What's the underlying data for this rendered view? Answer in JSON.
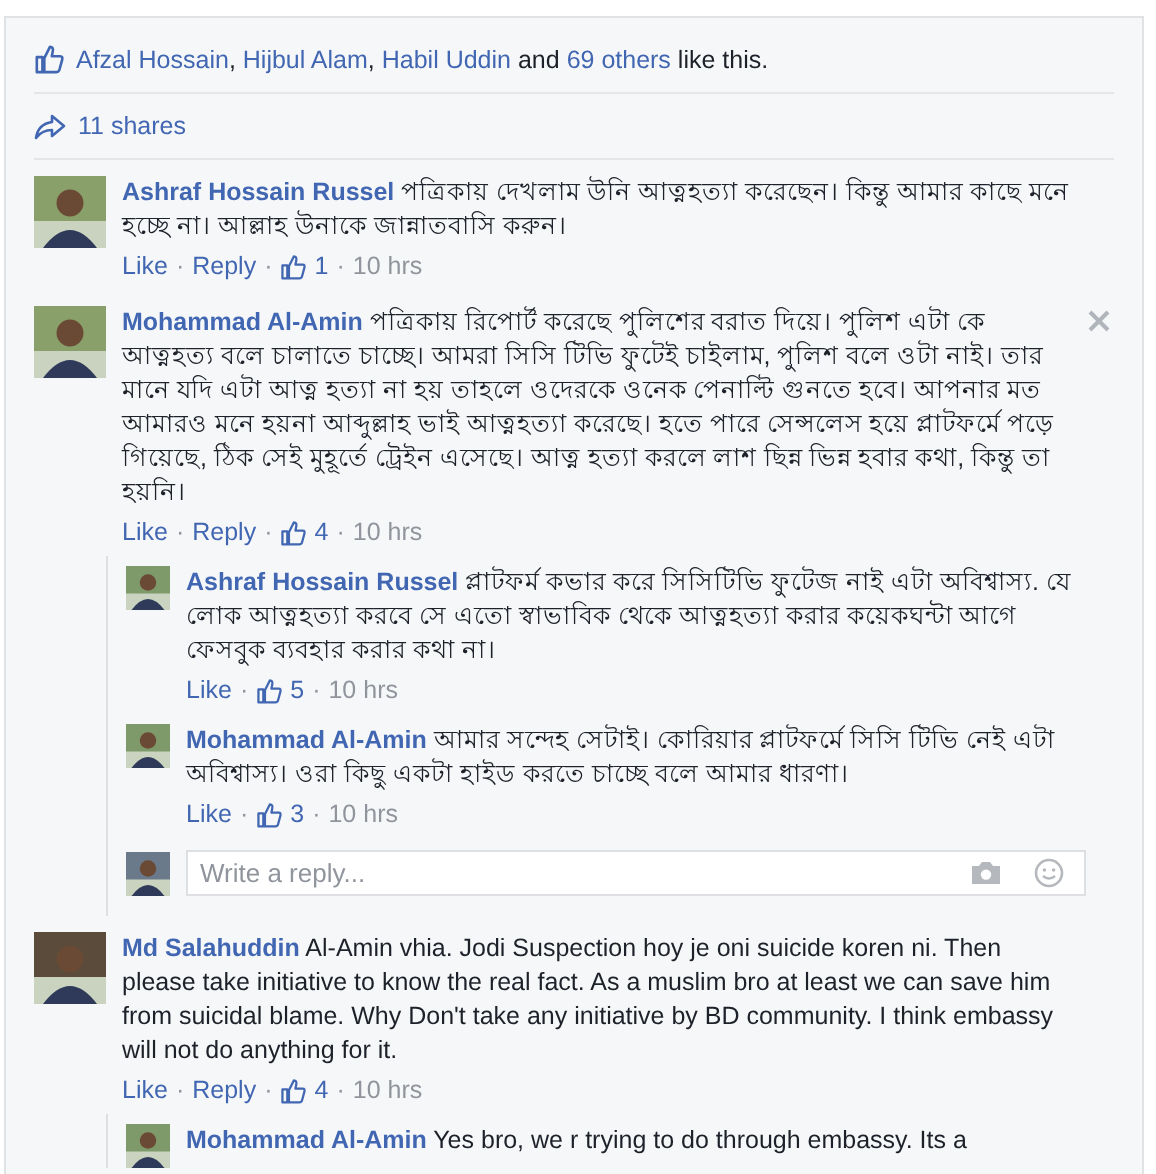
{
  "likes_line": {
    "parts": [
      {
        "text": "Afzal Hossain",
        "link": true
      },
      {
        "text": ", ",
        "link": false
      },
      {
        "text": "Hijbul Alam",
        "link": true
      },
      {
        "text": ", ",
        "link": false
      },
      {
        "text": "Habil Uddin",
        "link": true
      },
      {
        "text": " and ",
        "link": false
      },
      {
        "text": "69 others",
        "link": true
      },
      {
        "text": " like this.",
        "link": false
      }
    ]
  },
  "shares": "11 shares",
  "separator": "·",
  "comments": [
    {
      "author": "Ashraf Hossain Russel",
      "text": "পত্রিকায় দেখলাম উনি আত্নহত্যা করেছেন। কিন্তু আমার কাছে মনে হচ্ছে না। আল্লাহ উনাকে জান্নাতবাসি করুন।",
      "like": "Like",
      "reply": "Reply",
      "likes": "1",
      "time": "10 hrs",
      "closable": false
    },
    {
      "author": "Mohammad Al-Amin",
      "text": "পত্রিকায় রিপোর্ট করেছে পুলিশের বরাত দিয়ে। পুলিশ এটা কে আত্নহত্য বলে চালাতে চাচ্ছে। আমরা সিসি টিভি ফুটেই চাইলাম, পুলিশ বলে ওটা নাই। তার মানে যদি এটা আত্ন হত্যা না হয় তাহলে ওদেরকে ওনেক পেনাল্টি গুনতে হবে। আপনার মত আমারও মনে হয়না আব্দুল্লাহ ভাই আত্নহত্যা করেছে। হতে পারে সেন্সলেস হয়ে প্লাটফর্মে পড়ে গিয়েছে, ঠিক সেই মুহূর্তে ট্রেইন এসেছে। আত্ন হত্যা করলে লাশ ছিন্ন ভিন্ন হবার কথা, কিন্তু তা হয়নি।",
      "like": "Like",
      "reply": "Reply",
      "likes": "4",
      "time": "10 hrs",
      "closable": true,
      "replies": [
        {
          "author": "Ashraf Hossain Russel",
          "text": "প্লাটফর্ম কভার করে সিসিটিভি ফুটেজ নাই এটা অবিশ্বাস্য. যে লোক আত্নহত্যা করবে সে এতো স্বাভাবিক থেকে আত্নহত্যা করার কয়েকঘন্টা আগে ফেসবুক ব্যবহার করার কথা না।",
          "like": "Like",
          "likes": "5",
          "time": "10 hrs"
        },
        {
          "author": "Mohammad Al-Amin",
          "text": "আমার সন্দেহ সেটাই। কোরিয়ার প্লাটফর্মে সিসি টিভি নেই এটা অবিশ্বাস্য। ওরা কিছু একটা হাইড করতে চাচ্ছে বলে আমার ধারণা।",
          "like": "Like",
          "likes": "3",
          "time": "10 hrs"
        }
      ],
      "reply_box": {
        "placeholder": "Write a reply..."
      }
    },
    {
      "author": "Md Salahuddin",
      "text": "Al-Amin vhia. Jodi Suspection hoy je oni suicide koren ni. Then please take initiative to know the real fact. As a muslim bro at least we can save him from suicidal blame. Why Don't take any initiative by BD community. I think embassy will not do anything for it.",
      "like": "Like",
      "reply": "Reply",
      "likes": "4",
      "time": "10 hrs",
      "closable": false,
      "replies": [
        {
          "author": "Mohammad Al-Amin",
          "text": "Yes bro, we r trying to do through embassy. Its a"
        }
      ]
    }
  ]
}
